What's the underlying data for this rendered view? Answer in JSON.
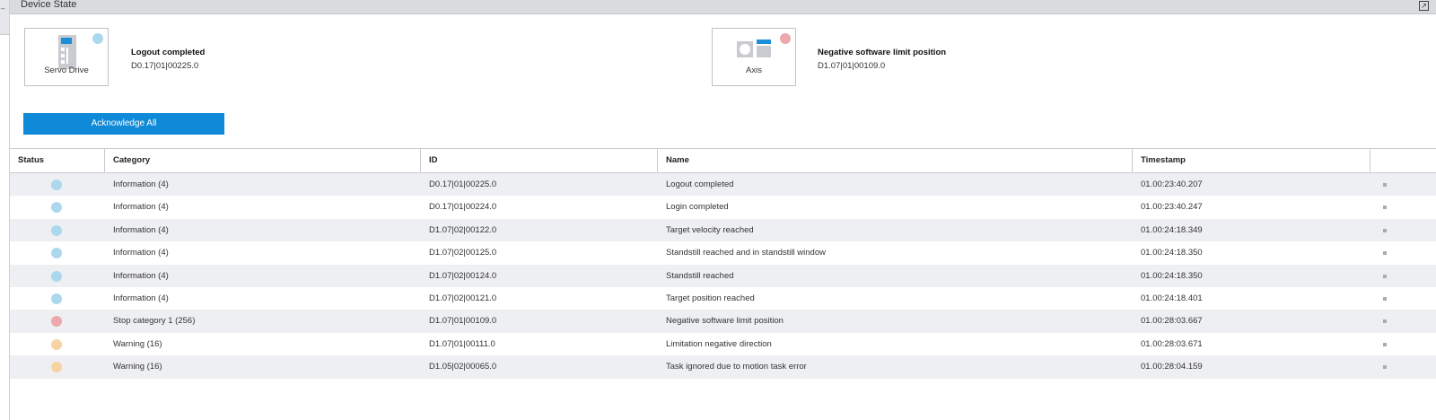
{
  "window": {
    "title": "Device State"
  },
  "devices": [
    {
      "name": "Servo Drive",
      "status": "info",
      "message": "Logout completed",
      "code": "D0.17|01|00225.0"
    },
    {
      "name": "Axis",
      "status": "stop",
      "message": "Negative software limit position",
      "code": "D1.07|01|00109.0"
    }
  ],
  "actions": {
    "acknowledge_all": "Acknowledge All"
  },
  "table": {
    "columns": [
      "Status",
      "Category",
      "ID",
      "Name",
      "Timestamp"
    ],
    "rows": [
      {
        "status": "info",
        "category": "Information (4)",
        "id": "D0.17|01|00225.0",
        "name": "Logout completed",
        "timestamp": "01.00:23:40.207"
      },
      {
        "status": "info",
        "category": "Information (4)",
        "id": "D0.17|01|00224.0",
        "name": "Login completed",
        "timestamp": "01.00:23:40.247"
      },
      {
        "status": "info",
        "category": "Information (4)",
        "id": "D1.07|02|00122.0",
        "name": "Target velocity reached",
        "timestamp": "01.00:24:18.349"
      },
      {
        "status": "info",
        "category": "Information (4)",
        "id": "D1.07|02|00125.0",
        "name": "Standstill reached and in standstill window",
        "timestamp": "01.00:24:18.350"
      },
      {
        "status": "info",
        "category": "Information (4)",
        "id": "D1.07|02|00124.0",
        "name": "Standstill reached",
        "timestamp": "01.00:24:18.350"
      },
      {
        "status": "info",
        "category": "Information (4)",
        "id": "D1.07|02|00121.0",
        "name": "Target position reached",
        "timestamp": "01.00:24:18.401"
      },
      {
        "status": "stop",
        "category": "Stop category 1 (256)",
        "id": "D1.07|01|00109.0",
        "name": "Negative software limit position",
        "timestamp": "01.00:28:03.667"
      },
      {
        "status": "warn",
        "category": "Warning (16)",
        "id": "D1.07|01|00111.0",
        "name": "Limitation negative direction",
        "timestamp": "01.00:28:03.671"
      },
      {
        "status": "warn",
        "category": "Warning (16)",
        "id": "D1.05|02|00065.0",
        "name": "Task ignored due to motion task error",
        "timestamp": "01.00:28:04.159"
      }
    ]
  },
  "colors": {
    "accent": "#0f8ad8",
    "info": "#acd8ee",
    "stop": "#eba8ad",
    "warn": "#f7d3a3",
    "row_alt": "#eeeff2"
  }
}
